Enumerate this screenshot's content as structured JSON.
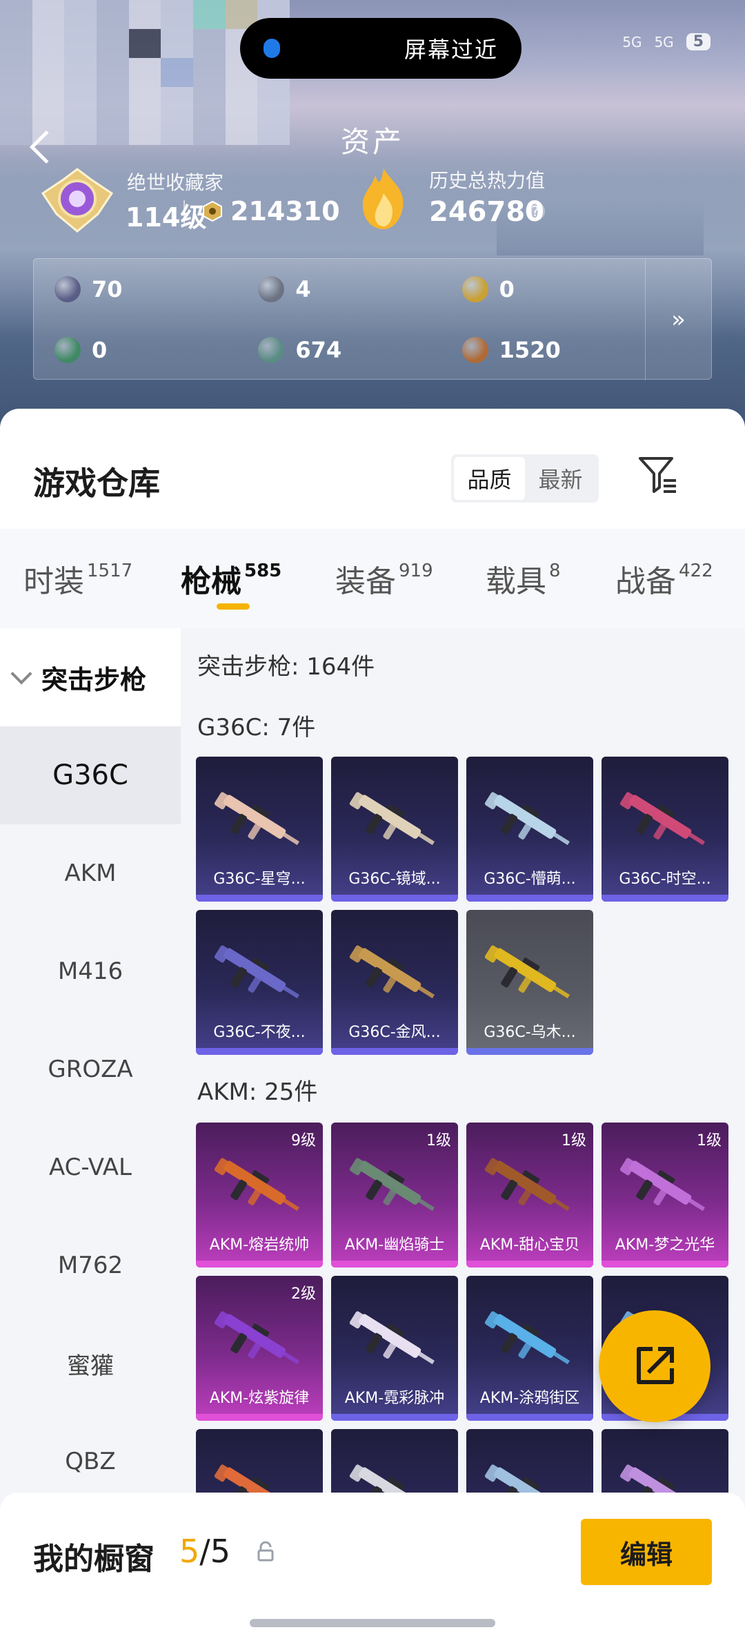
{
  "status": {
    "notch_text": "屏幕过近",
    "signal1": "5G",
    "signal2": "5G",
    "battery": "5"
  },
  "header": {
    "title": "资产",
    "rank_title": "绝世收藏家",
    "rank_level": "114级",
    "coin_value": "214310",
    "heat_label": "历史总热力值",
    "heat_value": "246780",
    "help": "?"
  },
  "assets": [
    {
      "icon": "card-icon",
      "color": "#5a5d86",
      "value": "70"
    },
    {
      "icon": "badge-round-icon",
      "color": "#6c7384",
      "value": "4"
    },
    {
      "icon": "gold-token-icon",
      "color": "#c9a032",
      "value": "0"
    },
    {
      "icon": "green-card-icon",
      "color": "#3f8a64",
      "value": "0"
    },
    {
      "icon": "teal-orb-icon",
      "color": "#5a8c84",
      "value": "674"
    },
    {
      "icon": "bronze-coin-icon",
      "color": "#b06a36",
      "value": "1520"
    }
  ],
  "assets_more": "»",
  "sheet": {
    "title": "游戏仓库",
    "sort_quality": "品质",
    "sort_latest": "最新"
  },
  "tabs": [
    {
      "label": "时装",
      "count": "1517"
    },
    {
      "label": "枪械",
      "count": "585"
    },
    {
      "label": "装备",
      "count": "919"
    },
    {
      "label": "载具",
      "count": "8"
    },
    {
      "label": "战备",
      "count": "422"
    }
  ],
  "category": {
    "head": "突击步枪",
    "items": [
      "G36C",
      "AKM",
      "M416",
      "GROZA",
      "AC-VAL",
      "M762",
      "蜜獾",
      "QBZ"
    ]
  },
  "grid": {
    "summary": "突击步枪: 164件",
    "g36c_label": "G36C: 7件",
    "akm_label": "AKM: 25件",
    "g36c_items": [
      {
        "name": "G36C-星穹...",
        "rarity": "purple",
        "gun_color": "#e9c4b0"
      },
      {
        "name": "G36C-镜域...",
        "rarity": "purple",
        "gun_color": "#e0d2b8"
      },
      {
        "name": "G36C-懵萌...",
        "rarity": "purple",
        "gun_color": "#b8d4e8"
      },
      {
        "name": "G36C-时空...",
        "rarity": "purple",
        "gun_color": "#d04a78"
      },
      {
        "name": "G36C-不夜...",
        "rarity": "purple",
        "gun_color": "#6a68c8"
      },
      {
        "name": "G36C-金风...",
        "rarity": "purple",
        "gun_color": "#c89a50"
      },
      {
        "name": "G36C-乌木...",
        "rarity": "grey",
        "gun_color": "#e0b820"
      }
    ],
    "akm_items": [
      {
        "name": "AKM-熔岩统帅",
        "rarity": "pink",
        "level": "9级",
        "gun_color": "#d86a2a"
      },
      {
        "name": "AKM-幽焰骑士",
        "rarity": "pink",
        "level": "1级",
        "gun_color": "#6a8a74"
      },
      {
        "name": "AKM-甜心宝贝",
        "rarity": "pink",
        "level": "1级",
        "gun_color": "#a05a2a"
      },
      {
        "name": "AKM-梦之光华",
        "rarity": "pink",
        "level": "1级",
        "gun_color": "#c070d8"
      },
      {
        "name": "AKM-炫紫旋律",
        "rarity": "pink",
        "level": "2级",
        "gun_color": "#8a40d0"
      },
      {
        "name": "AKM-霓彩脉冲",
        "rarity": "purple",
        "level": "",
        "gun_color": "#e8e0f0"
      },
      {
        "name": "AKM-涂鸦街区",
        "rarity": "purple",
        "level": "",
        "gun_color": "#5ab0e8"
      },
      {
        "name": "",
        "rarity": "purple",
        "level": "",
        "gun_color": "#7ab8e8"
      },
      {
        "name": "",
        "rarity": "purple",
        "level": "",
        "gun_color": "#e06a3a"
      },
      {
        "name": "",
        "rarity": "purple",
        "level": "",
        "gun_color": "#d8d8e0"
      },
      {
        "name": "",
        "rarity": "purple",
        "level": "",
        "gun_color": "#a0c0e0"
      },
      {
        "name": "",
        "rarity": "purple",
        "level": "",
        "gun_color": "#c090e0"
      }
    ]
  },
  "bottom": {
    "showcase_label": "我的橱窗",
    "count_current": "5",
    "count_sep": "/",
    "count_total": "5",
    "edit_label": "编辑"
  }
}
